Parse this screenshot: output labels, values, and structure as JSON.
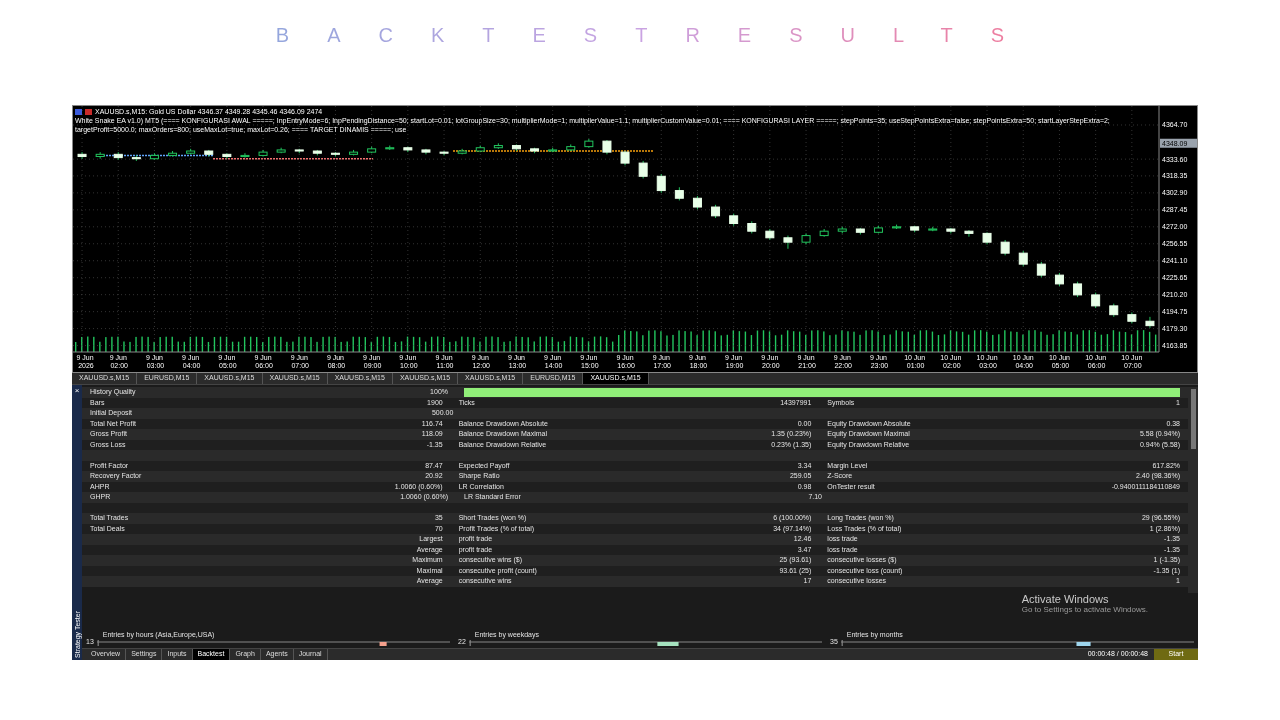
{
  "title": "BACKTESTRESULTS",
  "chart": {
    "header_line": "XAUUSD.s,M15:  Gold US Dollar  4346.37 4349.28 4345.46 4346.09  2474",
    "ea_line": "White Snake EA v1.0) MT5 (==== KONFIGURASI AWAL =====; InpEntryMode=6; InpPendingDistance=50; startLot=0.01; lotGroupSize=30; multiplierMode=1; multiplierValue=1.1; multiplierCustomValue=0.01; ==== KONFIGURASI LAYER =====; stepPoints=35; useStepPointsExtra=false; stepPointsExtra=50; startLayerStepExtra=2; targetProfit=5000.0; maxOrders=800; useMaxLot=true; maxLot=0.26; ==== TARGET DINAMIS =====; use",
    "current_price": "4348.09",
    "chart_data": {
      "type": "candlestick",
      "categories": [
        "9 Jun 2026",
        null,
        "9 Jun 02:00",
        null,
        "9 Jun 03:00",
        null,
        "9 Jun 04:00",
        null,
        "9 Jun 05:00",
        null,
        "9 Jun 06:00",
        null,
        "9 Jun 07:00",
        null,
        "9 Jun 08:00",
        null,
        "9 Jun 09:00",
        null,
        "9 Jun 10:00",
        null,
        "9 Jun 11:00",
        null,
        "9 Jun 12:00",
        null,
        "9 Jun 13:00",
        null,
        "9 Jun 14:00",
        null,
        "9 Jun 15:00",
        null,
        "9 Jun 16:00",
        null,
        "9 Jun 17:00",
        null,
        "9 Jun 18:00",
        null,
        "9 Jun 19:00",
        null,
        "9 Jun 20:00",
        null,
        "9 Jun 21:00",
        null,
        "9 Jun 22:00",
        null,
        "9 Jun 23:00",
        null,
        "10 Jun 01:00",
        null,
        "10 Jun 02:00",
        null,
        "10 Jun 03:00",
        null,
        "10 Jun 04:00",
        null,
        "10 Jun 05:00",
        null,
        "10 Jun 06:00",
        null,
        "10 Jun 07:00",
        null
      ],
      "ohlc": [
        [
          4338,
          4340,
          4334,
          4336
        ],
        [
          4336,
          4340,
          4334,
          4338
        ],
        [
          4338,
          4340,
          4333,
          4335
        ],
        [
          4335,
          4337,
          4332,
          4334
        ],
        [
          4334,
          4339,
          4333,
          4337
        ],
        [
          4337,
          4341,
          4336,
          4339
        ],
        [
          4339,
          4343,
          4338,
          4341
        ],
        [
          4341,
          4342,
          4336,
          4338
        ],
        [
          4338,
          4339,
          4334,
          4336
        ],
        [
          4336,
          4339,
          4335,
          4337
        ],
        [
          4337,
          4342,
          4336,
          4340
        ],
        [
          4340,
          4344,
          4339,
          4342
        ],
        [
          4342,
          4343,
          4339,
          4341
        ],
        [
          4341,
          4342,
          4337,
          4339
        ],
        [
          4339,
          4340,
          4336,
          4338
        ],
        [
          4338,
          4342,
          4337,
          4340
        ],
        [
          4340,
          4345,
          4339,
          4343
        ],
        [
          4343,
          4346,
          4342,
          4344
        ],
        [
          4344,
          4345,
          4340,
          4342
        ],
        [
          4342,
          4343,
          4338,
          4340
        ],
        [
          4340,
          4341,
          4337,
          4339
        ],
        [
          4339,
          4343,
          4338,
          4341
        ],
        [
          4341,
          4346,
          4340,
          4344
        ],
        [
          4344,
          4348,
          4343,
          4346
        ],
        [
          4346,
          4347,
          4341,
          4343
        ],
        [
          4343,
          4344,
          4339,
          4341
        ],
        [
          4341,
          4344,
          4340,
          4342
        ],
        [
          4342,
          4347,
          4341,
          4345
        ],
        [
          4345,
          4352,
          4344,
          4350
        ],
        [
          4350,
          4351,
          4338,
          4340
        ],
        [
          4340,
          4341,
          4328,
          4330
        ],
        [
          4330,
          4332,
          4316,
          4318
        ],
        [
          4318,
          4320,
          4303,
          4305
        ],
        [
          4305,
          4308,
          4296,
          4298
        ],
        [
          4298,
          4300,
          4288,
          4290
        ],
        [
          4290,
          4292,
          4280,
          4282
        ],
        [
          4282,
          4284,
          4273,
          4275
        ],
        [
          4275,
          4277,
          4266,
          4268
        ],
        [
          4268,
          4270,
          4260,
          4262
        ],
        [
          4262,
          4264,
          4252,
          4258
        ],
        [
          4258,
          4266,
          4256,
          4264
        ],
        [
          4264,
          4270,
          4263,
          4268
        ],
        [
          4268,
          4272,
          4266,
          4270
        ],
        [
          4270,
          4271,
          4265,
          4267
        ],
        [
          4267,
          4273,
          4266,
          4271
        ],
        [
          4271,
          4274,
          4270,
          4272
        ],
        [
          4272,
          4273,
          4267,
          4269
        ],
        [
          4269,
          4272,
          4268,
          4270
        ],
        [
          4270,
          4271,
          4266,
          4268
        ],
        [
          4268,
          4269,
          4263,
          4266
        ],
        [
          4266,
          4267,
          4256,
          4258
        ],
        [
          4258,
          4260,
          4246,
          4248
        ],
        [
          4248,
          4250,
          4236,
          4238
        ],
        [
          4238,
          4240,
          4226,
          4228
        ],
        [
          4228,
          4230,
          4218,
          4220
        ],
        [
          4220,
          4222,
          4208,
          4210
        ],
        [
          4210,
          4212,
          4198,
          4200
        ],
        [
          4200,
          4202,
          4190,
          4192
        ],
        [
          4192,
          4194,
          4184,
          4186
        ],
        [
          4186,
          4190,
          4180,
          4182
        ]
      ],
      "ylim": [
        4158,
        4382
      ],
      "grid": true,
      "yticks": [
        {
          "value": 4364.7,
          "label": "4364.70"
        },
        {
          "value": 4333.6,
          "label": "4333.60"
        },
        {
          "value": 4318.35,
          "label": "4318.35"
        },
        {
          "value": 4302.9,
          "label": "4302.90"
        },
        {
          "value": 4287.45,
          "label": "4287.45"
        },
        {
          "value": 4272,
          "label": "4272.00"
        },
        {
          "value": 4256.55,
          "label": "4256.55"
        },
        {
          "value": 4241.1,
          "label": "4241.10"
        },
        {
          "value": 4225.65,
          "label": "4225.65"
        },
        {
          "value": 4210.2,
          "label": "4210.20"
        },
        {
          "value": 4194.75,
          "label": "4194.75"
        },
        {
          "value": 4179.3,
          "label": "4179.30"
        },
        {
          "value": 4163.85,
          "label": "4163.85"
        }
      ]
    }
  },
  "chart_tabs": [
    {
      "label": "XAUUSD.s,M15",
      "selected": false
    },
    {
      "label": "EURUSD,M15",
      "selected": false
    },
    {
      "label": "XAUUSD.s,M15",
      "selected": false
    },
    {
      "label": "XAUUSD.s,M15",
      "selected": false
    },
    {
      "label": "XAUUSD.s,M15",
      "selected": false
    },
    {
      "label": "XAUUSD.s,M15",
      "selected": false
    },
    {
      "label": "XAUUSD.s,M15",
      "selected": false
    },
    {
      "label": "EURUSD,M15",
      "selected": false
    },
    {
      "label": "XAUUSD.s,M15",
      "selected": true
    }
  ],
  "tester": {
    "close": "×",
    "side_label": "Strategy Tester",
    "rows": [
      {
        "kind": "quality",
        "left": {
          "label": "History Quality",
          "value": "100%"
        },
        "level": 1
      },
      {
        "kind": "stat",
        "left": {
          "label": "Bars",
          "value": "1900"
        },
        "middle": {
          "label": "Ticks",
          "value": "14397991"
        },
        "right": {
          "label": "Symbols",
          "value": "1"
        }
      },
      {
        "kind": "stat",
        "left": {
          "label": "Initial Deposit",
          "value": "500.00"
        }
      },
      {
        "kind": "stat",
        "left": {
          "label": "Total Net Profit",
          "value": "116.74"
        },
        "middle": {
          "label": "Balance Drawdown Absolute",
          "value": "0.00"
        },
        "right": {
          "label": "Equity Drawdown Absolute",
          "value": "0.38"
        }
      },
      {
        "kind": "stat",
        "left": {
          "label": "Gross Profit",
          "value": "118.09"
        },
        "middle": {
          "label": "Balance Drawdown Maximal",
          "value": "1.35 (0.23%)"
        },
        "right": {
          "label": "Equity Drawdown Maximal",
          "value": "5.58 (0.94%)"
        }
      },
      {
        "kind": "stat",
        "left": {
          "label": "Gross Loss",
          "value": "-1.35"
        },
        "middle": {
          "label": "Balance Drawdown Relative",
          "value": "0.23% (1.35)"
        },
        "right": {
          "label": "Equity Drawdown Relative",
          "value": "0.94% (5.58)"
        }
      },
      {
        "kind": "spacer"
      },
      {
        "kind": "stat",
        "left": {
          "label": "Profit Factor",
          "value": "87.47"
        },
        "middle": {
          "label": "Expected Payoff",
          "value": "3.34"
        },
        "right": {
          "label": "Margin Level",
          "value": "617.82%"
        }
      },
      {
        "kind": "stat",
        "left": {
          "label": "Recovery Factor",
          "value": "20.92"
        },
        "middle": {
          "label": "Sharpe Ratio",
          "value": "259.05"
        },
        "right": {
          "label": "Z-Score",
          "value": "2.40 (98.36%)"
        }
      },
      {
        "kind": "stat",
        "left": {
          "label": "AHPR",
          "value": "1.0060 (0.60%)"
        },
        "middle": {
          "label": "LR Correlation",
          "value": "0.98"
        },
        "right": {
          "label": "OnTester result",
          "value": "-0.9400111184110849"
        }
      },
      {
        "kind": "stat",
        "left": {
          "label": "GHPR",
          "value": "1.0060 (0.60%)"
        },
        "middle": {
          "label": "LR Standard Error",
          "value": "7.10"
        }
      },
      {
        "kind": "spacer"
      },
      {
        "kind": "stat",
        "left": {
          "label": "Total Trades",
          "value": "35"
        },
        "middle": {
          "label": "Short Trades (won %)",
          "value": "6 (100.00%)"
        },
        "right": {
          "label": "Long Trades (won %)",
          "value": "29 (96.55%)"
        }
      },
      {
        "kind": "stat",
        "left": {
          "label": "Total Deals",
          "value": "70"
        },
        "middle": {
          "label": "Profit Trades (% of total)",
          "value": "34 (97.14%)"
        },
        "right": {
          "label": "Loss Trades (% of total)",
          "value": "1 (2.86%)"
        }
      },
      {
        "kind": "stat",
        "left": {
          "value": "Largest"
        },
        "middle": {
          "label": "profit trade",
          "value": "12.46"
        },
        "right": {
          "label": "loss trade",
          "value": "-1.35"
        }
      },
      {
        "kind": "stat",
        "left": {
          "value": "Average"
        },
        "middle": {
          "label": "profit trade",
          "value": "3.47"
        },
        "right": {
          "label": "loss trade",
          "value": "-1.35"
        }
      },
      {
        "kind": "stat",
        "left": {
          "value": "Maximum"
        },
        "middle": {
          "label": "consecutive wins ($)",
          "value": "25 (93.61)"
        },
        "right": {
          "label": "consecutive losses ($)",
          "value": "1 (-1.35)"
        }
      },
      {
        "kind": "stat",
        "left": {
          "value": "Maximal"
        },
        "middle": {
          "label": "consecutive profit (count)",
          "value": "93.61 (25)"
        },
        "right": {
          "label": "consecutive loss (count)",
          "value": "-1.35 (1)"
        }
      },
      {
        "kind": "stat",
        "left": {
          "value": "Average"
        },
        "middle": {
          "label": "consecutive wins",
          "value": "17"
        },
        "right": {
          "label": "consecutive losses",
          "value": "1"
        }
      }
    ],
    "entries": [
      {
        "title": "Entries by hours (Asia,Europe,USA)",
        "axis": "13",
        "color": "#f4a08c"
      },
      {
        "title": "Entries by weekdays",
        "axis": "22",
        "color": "#a6e3c0"
      },
      {
        "title": "Entries by months",
        "axis": "35",
        "color": "#9fd6ee"
      }
    ],
    "tabs": [
      {
        "label": "Overview",
        "selected": false
      },
      {
        "label": "Settings",
        "selected": false
      },
      {
        "label": "Inputs",
        "selected": false
      },
      {
        "label": "Backtest",
        "selected": true
      },
      {
        "label": "Graph",
        "selected": false
      },
      {
        "label": "Agents",
        "selected": false
      },
      {
        "label": "Journal",
        "selected": false
      }
    ],
    "timer": "00:00:48 / 00:00:48",
    "start": "Start"
  },
  "os_notice": {
    "title": "Activate Windows",
    "text": "Go to Settings to activate Windows."
  }
}
